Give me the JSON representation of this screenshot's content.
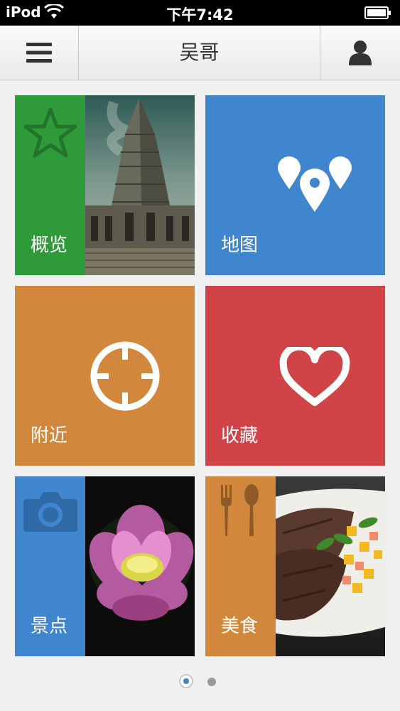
{
  "status_bar": {
    "carrier": "iPod",
    "time": "下午7:42"
  },
  "nav": {
    "title": "吴哥",
    "menu_icon": "hamburger-menu-icon",
    "profile_icon": "user-icon"
  },
  "tiles": [
    {
      "label": "概览",
      "icon": "star-icon",
      "color": "#2e9a3a"
    },
    {
      "label": "地图",
      "icon": "map-pins-icon",
      "color": "#3f86cf"
    },
    {
      "label": "附近",
      "icon": "crosshair-icon",
      "color": "#d2883c"
    },
    {
      "label": "收藏",
      "icon": "heart-icon",
      "color": "#d04447"
    },
    {
      "label": "景点",
      "icon": "camera-icon",
      "color": "#3f86cf"
    },
    {
      "label": "美食",
      "icon": "fork-spoon-icon",
      "color": "#d2883c"
    }
  ],
  "pager": {
    "pages": 2,
    "current": 1
  }
}
